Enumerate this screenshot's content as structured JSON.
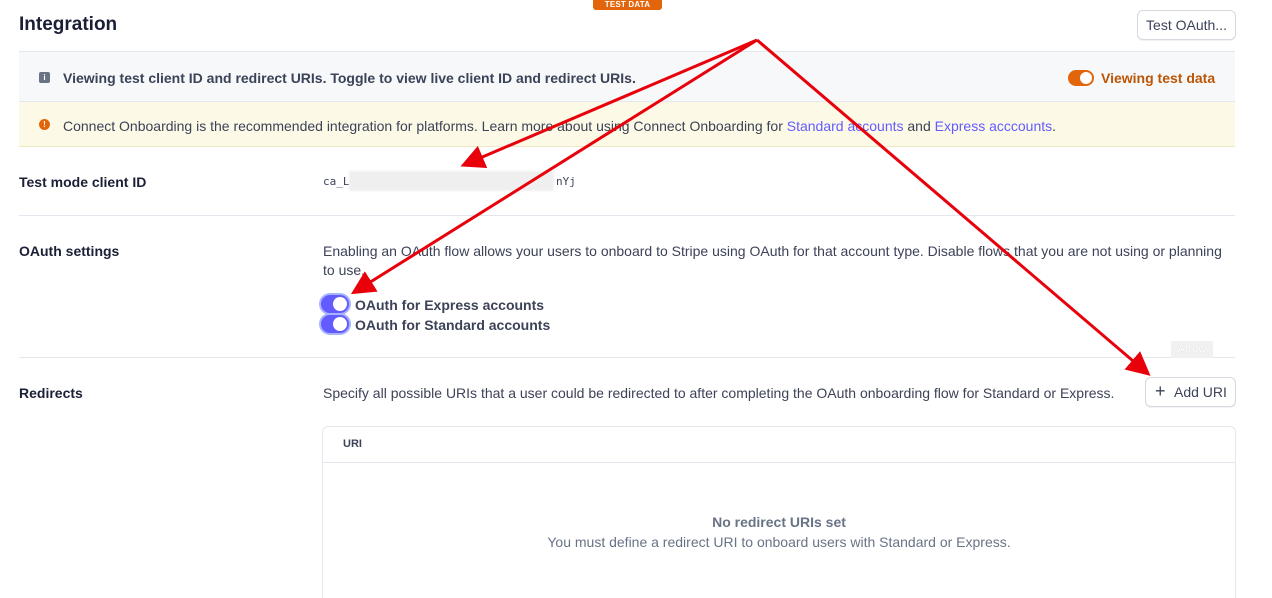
{
  "header": {
    "test_badge": "TEST DATA",
    "title": "Integration",
    "test_oauth_label": "Test OAuth..."
  },
  "info_banner": {
    "icon": "info-icon",
    "text": "Viewing test client ID and redirect URIs. Toggle to view live client ID and redirect URIs.",
    "toggle_label": "Viewing test data",
    "toggle_on": true,
    "toggle_color": "#e3650b"
  },
  "warning_banner": {
    "icon": "warning-icon",
    "text_before": "Connect Onboarding is the recommended integration for platforms. Learn more about using Connect Onboarding for ",
    "link_standard": "Standard accounts",
    "text_and": " and ",
    "link_express": "Express acccounts",
    "text_after": "."
  },
  "client_id": {
    "label": "Test mode client ID",
    "prefix": "ca_L",
    "suffix": "nYj"
  },
  "oauth_settings": {
    "label": "OAuth settings",
    "description": "Enabling an OAuth flow allows your users to onboard to Stripe using OAuth for that account type. Disable flows that you are not using or planning to use.",
    "switches": [
      {
        "label": "OAuth for Express accounts",
        "on": true
      },
      {
        "label": "OAuth for Standard accounts",
        "on": true
      }
    ],
    "accent": "#635bff"
  },
  "redirects": {
    "label": "Redirects",
    "description": "Specify all possible URIs that a user could be redirected to after completing the OAuth onboarding flow for Standard or Express.",
    "add_uri_label": "Add URI",
    "tooltip": "Arrow",
    "table": {
      "column_header": "URI",
      "empty_title": "No redirect URIs set",
      "empty_subtitle": "You must define a redirect URI to onboard users with Standard or Express."
    }
  },
  "annotation_color": "#e8000b"
}
